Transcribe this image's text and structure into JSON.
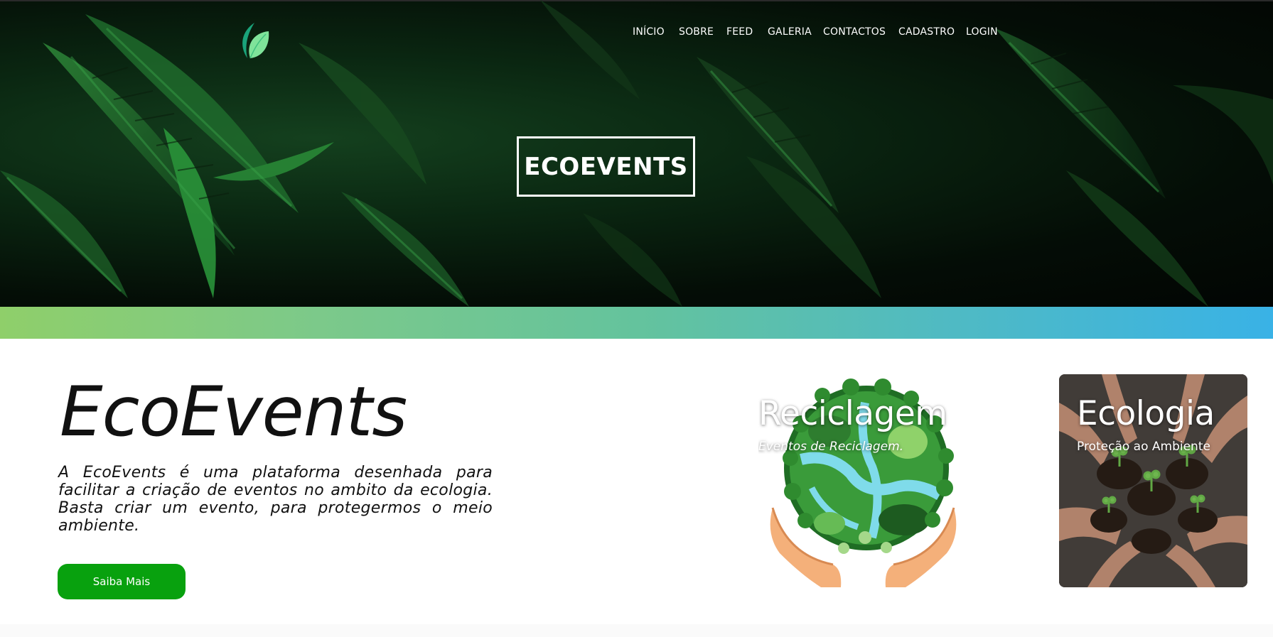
{
  "nav": {
    "items": [
      "INÍCIO",
      "SOBRE",
      "FEED",
      "GALERIA",
      "CONTACTOS",
      "CADASTRO",
      "LOGIN"
    ]
  },
  "logo": {
    "icon": "leaf-icon",
    "colors": [
      "#1aa37a",
      "#7fe39a"
    ]
  },
  "hero": {
    "brand": "ECOEVENTS",
    "band_gradient": [
      "#8fcf6a",
      "#39b2e6"
    ]
  },
  "intro": {
    "title": "EcoEvents",
    "description": "A EcoEvents é uma plataforma desenhada para facilitar a criação de eventos no ambito da ecologia. Basta criar um evento, para protegermos o meio ambiente.",
    "button_label": "Saiba Mais",
    "button_color": "#08a10e"
  },
  "cards": [
    {
      "title": "Reciclagem",
      "subtitle": "Eventos de Reciclagem."
    },
    {
      "title": "Ecologia",
      "subtitle": "Proteção ao Ambiente"
    }
  ]
}
